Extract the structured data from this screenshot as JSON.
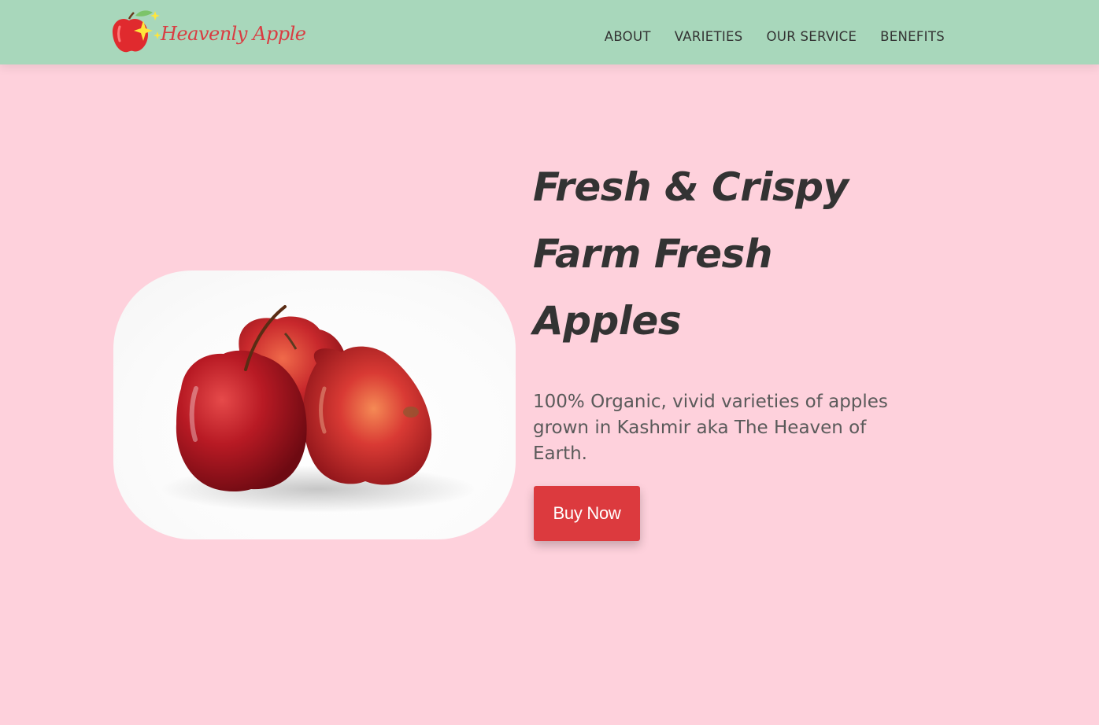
{
  "brand": {
    "name": "Heavenly Apple",
    "logo_icon": "apple-sparkle-icon"
  },
  "nav": {
    "items": [
      {
        "label": "ABOUT"
      },
      {
        "label": "VARIETIES"
      },
      {
        "label": "OUR SERVICE"
      },
      {
        "label": "BENEFITS"
      }
    ]
  },
  "hero": {
    "title_lines": [
      "Fresh & Crispy",
      "Farm Fresh",
      "Apples"
    ],
    "description": "100% Organic, vivid varieties of apples grown in Kashmir aka The Heaven of Earth.",
    "cta_label": "Buy Now",
    "image": "three-red-apples-photo"
  },
  "colors": {
    "navbar_bg": "#a8d7bb",
    "page_bg": "#fed1dc",
    "brand_red": "#d93d42",
    "button_red": "#dc3a3e",
    "heading_text": "#333333"
  }
}
